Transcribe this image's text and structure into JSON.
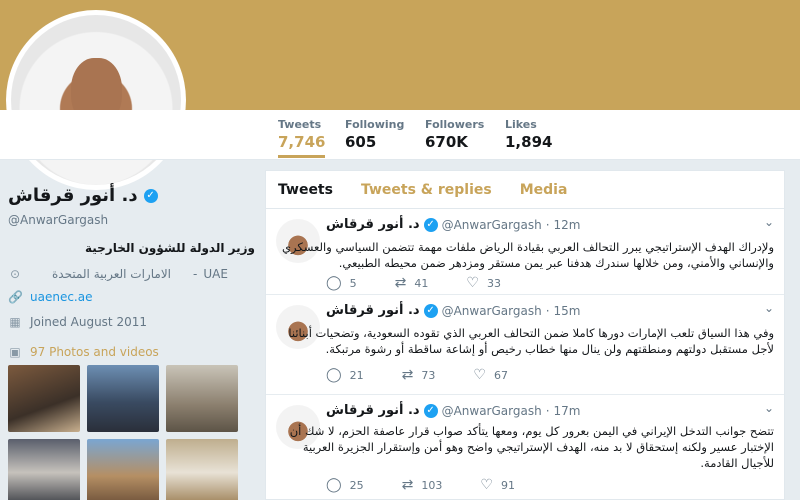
{
  "profile": {
    "name": "د. أنور قرقاش",
    "handle": "@AnwarGargash",
    "bio": "وزير الدولة للشؤون الخارجية",
    "location_en": "UAE",
    "location_sep": "-",
    "location_ar": "الامارات العربية المتحدة",
    "url": "uaenec.ae",
    "joined": "Joined August 2011",
    "photos": "97 Photos and videos"
  },
  "stats": [
    {
      "label": "Tweets",
      "value": "7,746"
    },
    {
      "label": "Following",
      "value": "605"
    },
    {
      "label": "Followers",
      "value": "670K"
    },
    {
      "label": "Likes",
      "value": "1,894"
    }
  ],
  "tabs": [
    "Tweets",
    "Tweets & replies",
    "Media"
  ],
  "tweets": [
    {
      "name": "د. أنور قرقاش",
      "handle": "@AnwarGargash",
      "sep": "·",
      "time": "12m",
      "text": "ولإدراك الهدف الإستراتيجي يبرر التحالف العربي بقيادة الرياض ملفات مهمة تتضمن السياسي والعسكري والإنساني والأمني، ومن خلالها سندرك هدفنا عبر يمن مستقر ومزدهر ضمن محيطه الطبيعي.",
      "replies": "5",
      "retweets": "41",
      "likes": "33"
    },
    {
      "name": "د. أنور قرقاش",
      "handle": "@AnwarGargash",
      "sep": "·",
      "time": "15m",
      "text": "وفي هذا السياق تلعب الإمارات دورها كاملا ضمن التحالف العربي الذي تقوده السعودية، وتضحيات أبنائنا لأجل مستقبل دولتهم ومنطقتهم ولن ينال منها خطاب رخيص أو إشاعة ساقطة أو رشوة مرتبكة.",
      "replies": "21",
      "retweets": "73",
      "likes": "67"
    },
    {
      "name": "د. أنور قرقاش",
      "handle": "@AnwarGargash",
      "sep": "·",
      "time": "17m",
      "text": "تتضح جوانب التدخل الإيراني في اليمن بعرور كل يوم، ومعها يتأكد صواب قرار عاصفة الحزم، لا شك أن الإختبار عسير ولكنه إستحقاق لا بد منه، الهدف الإستراتيجي واضح وهو أمن وإستقرار الجزيرة العربية للأجيال القادمة.",
      "replies": "25",
      "retweets": "103",
      "likes": "91"
    }
  ],
  "colors": {
    "accent": "#c8a45a",
    "link": "#1b95e0",
    "verified": "#1da1f2"
  }
}
